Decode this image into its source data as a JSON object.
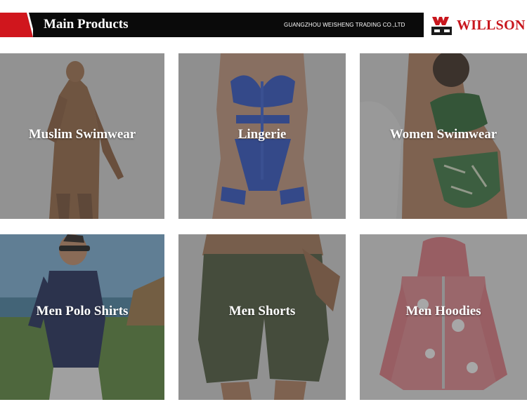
{
  "header": {
    "title": "Main Products",
    "company": "GUANGZHOU WEISHENG TRADING CO.,LTD",
    "logo_text": "WILLSON",
    "logo_icon": "willson-logo-icon",
    "colors": {
      "bar": "#0a0a0a",
      "accent": "#d0161d",
      "brand": "#c8161d"
    }
  },
  "products": [
    {
      "label": "Muslim Swimwear",
      "image": "muslim-swimwear-photo"
    },
    {
      "label": "Lingerie",
      "image": "lingerie-photo"
    },
    {
      "label": "Women Swimwear",
      "image": "women-swimwear-photo"
    },
    {
      "label": "Men Polo Shirts",
      "image": "men-polo-shirts-photo"
    },
    {
      "label": "Men Shorts",
      "image": "men-shorts-photo"
    },
    {
      "label": "Men Hoodies",
      "image": "men-hoodies-photo"
    }
  ]
}
